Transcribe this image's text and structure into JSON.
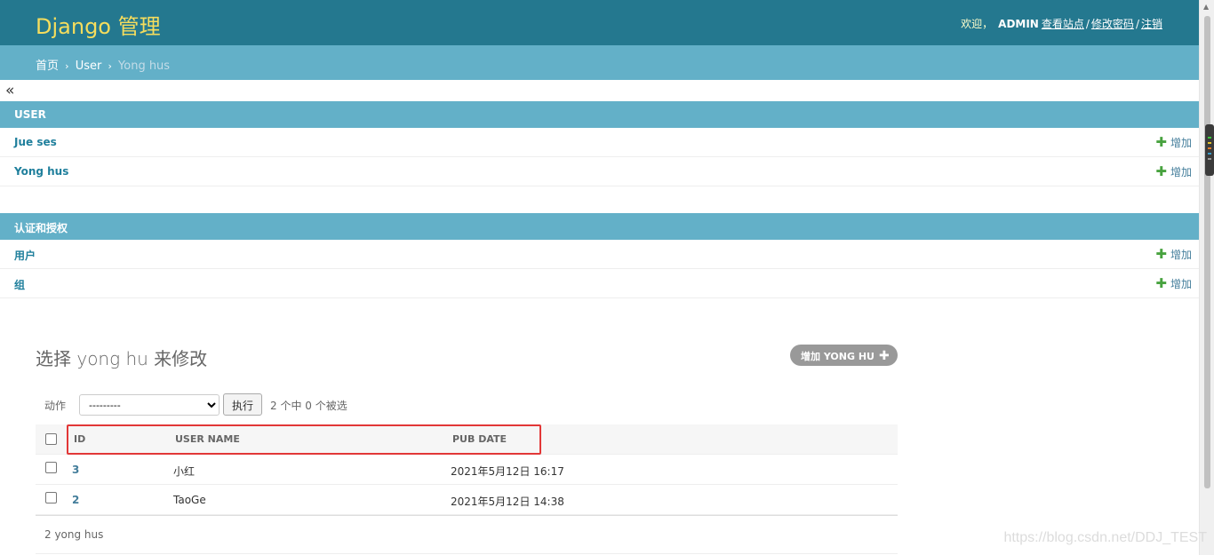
{
  "header": {
    "brand": "Django 管理",
    "welcome": "欢迎，",
    "user": "ADMIN",
    "view_site": "查看站点",
    "change_password": "修改密码",
    "logout": "注销",
    "separator": "/"
  },
  "breadcrumbs": {
    "home": "首页",
    "app": "User",
    "current": "Yong hus",
    "arrow": "›"
  },
  "nav_toggle": "«",
  "apps": [
    {
      "caption": "USER",
      "models": [
        {
          "name": "Jue ses",
          "add": "增加"
        },
        {
          "name": "Yong hus",
          "add": "增加"
        }
      ]
    },
    {
      "caption": "认证和授权",
      "models": [
        {
          "name": "用户",
          "add": "增加"
        },
        {
          "name": "组",
          "add": "增加"
        }
      ]
    }
  ],
  "content": {
    "title": "选择 yong hu 来修改",
    "add_button": "增加 YONG HU",
    "actions_label": "动作",
    "action_selected": "---------",
    "go_button": "执行",
    "counter": "2 个中 0 个被选",
    "columns": [
      "ID",
      "USER NAME",
      "PUB DATE"
    ],
    "rows": [
      {
        "id": "3",
        "user_name": "小红",
        "pub_date": "2021年5月12日 16:17"
      },
      {
        "id": "2",
        "user_name": "TaoGe",
        "pub_date": "2021年5月12日 14:38"
      }
    ],
    "result_count": "2 yong hus"
  },
  "watermark": "https://blog.csdn.net/DDJ_TEST",
  "colors": {
    "header_bg": "#24788f",
    "brand": "#f5dd5d",
    "module_caption_bg": "#63b0c8",
    "link": "#447e9b",
    "add_plus": "#48a23f",
    "highlight_border": "#e23737"
  }
}
